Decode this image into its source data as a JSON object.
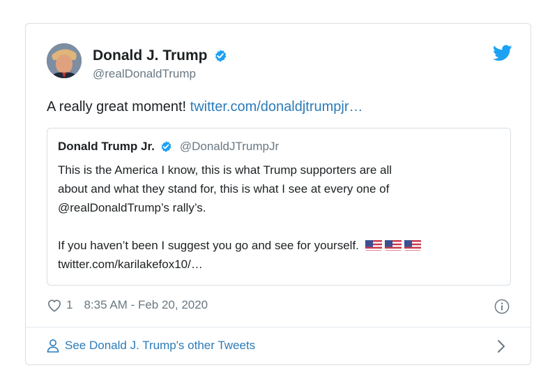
{
  "tweet": {
    "author_name": "Donald J. Trump",
    "author_handle": "@realDonaldTrump",
    "text": "A really great moment! ",
    "link": "twitter.com/donaldjtrumpjr…",
    "likes": "1",
    "timestamp": "8:35 AM - Feb 20, 2020"
  },
  "quoted": {
    "author_name": "Donald Trump Jr.",
    "author_handle": "@DonaldJTrumpJr",
    "line1": "This is the America I know, this is what Trump supporters are all",
    "line2": "about and what they stand for, this is what I see at every one of",
    "line3": "@realDonaldTrump’s rally’s.",
    "line4": "If you haven’t been I suggest you go and see for yourself.",
    "line5": "twitter.com/karilakefox10/…",
    "flags": [
      "us-flag-icon",
      "us-flag-icon",
      "us-flag-icon"
    ]
  },
  "footer": {
    "label": "See Donald J. Trump's other Tweets"
  },
  "icons": {
    "verified": "verified-badge-icon",
    "twitter": "twitter-bird-icon",
    "heart": "heart-icon",
    "info": "info-icon",
    "person": "person-icon",
    "chevron": "chevron-right-icon"
  },
  "colors": {
    "link": "#2b7bb9",
    "verified": "#1da1f2",
    "secondary_text": "#697882",
    "border": "#d8dee3"
  }
}
